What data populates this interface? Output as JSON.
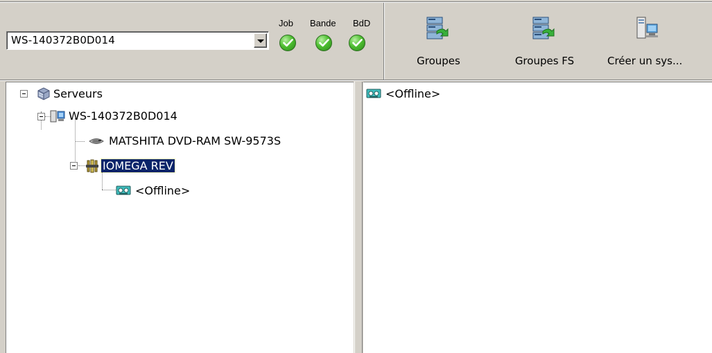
{
  "toolbar": {
    "server_selector": {
      "value": "WS-140372B0D014"
    },
    "status": [
      {
        "label": "Job",
        "state": "ok"
      },
      {
        "label": "Bande",
        "state": "ok"
      },
      {
        "label": "BdD",
        "state": "ok"
      }
    ],
    "buttons": [
      {
        "label": "Groupes",
        "icon": "groups-icon"
      },
      {
        "label": "Groupes FS",
        "icon": "fs-groups-icon"
      },
      {
        "label": "Créer un sys...",
        "icon": "create-system-icon"
      }
    ]
  },
  "tree": {
    "root": {
      "label": "Serveurs",
      "icon": "servers-icon"
    },
    "server": {
      "label": "WS-140372B0D014",
      "icon": "computer-icon"
    },
    "dvd": {
      "label": "MATSHITA DVD-RAM SW-9573S",
      "icon": "optical-drive-icon"
    },
    "rev": {
      "label": "IOMEGA REV",
      "icon": "tape-drive-icon",
      "selected": true
    },
    "media": {
      "label": "<Offline>",
      "icon": "cartridge-icon"
    }
  },
  "detail": {
    "items": [
      {
        "label": "<Offline>",
        "icon": "cartridge-icon"
      }
    ]
  },
  "colors": {
    "selection": "#0a246a",
    "status_ok": "#4fbf32",
    "chrome": "#d4d0c8"
  }
}
